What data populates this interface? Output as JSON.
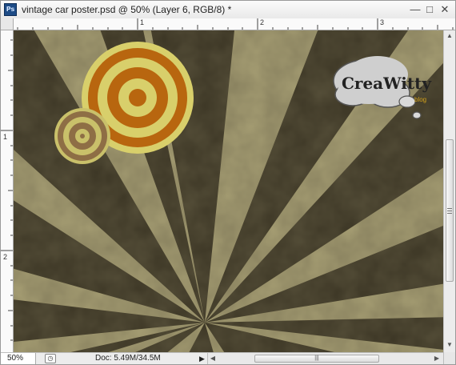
{
  "window": {
    "title": "vintage car poster.psd @ 50% (Layer 6, RGB/8) *",
    "app_icon_label": "Ps"
  },
  "window_controls": {
    "minimize": "—",
    "maximize": "□",
    "close": "✕"
  },
  "rulers": {
    "top_numbers": [
      "1",
      "2",
      "3"
    ],
    "left_numbers": [
      "1",
      "2"
    ]
  },
  "canvas": {
    "logo_text_main": "CreaWitty",
    "logo_text_sub": "blog",
    "colors": {
      "background_dark": "#3a3422",
      "ray_light": "#a69f73",
      "target_yellow": "#d7cf69",
      "target_orange": "#b86b16"
    }
  },
  "status": {
    "zoom": "50%",
    "doc": "Doc: 5.49M/34.5M",
    "hscroll_grip": "|||"
  }
}
